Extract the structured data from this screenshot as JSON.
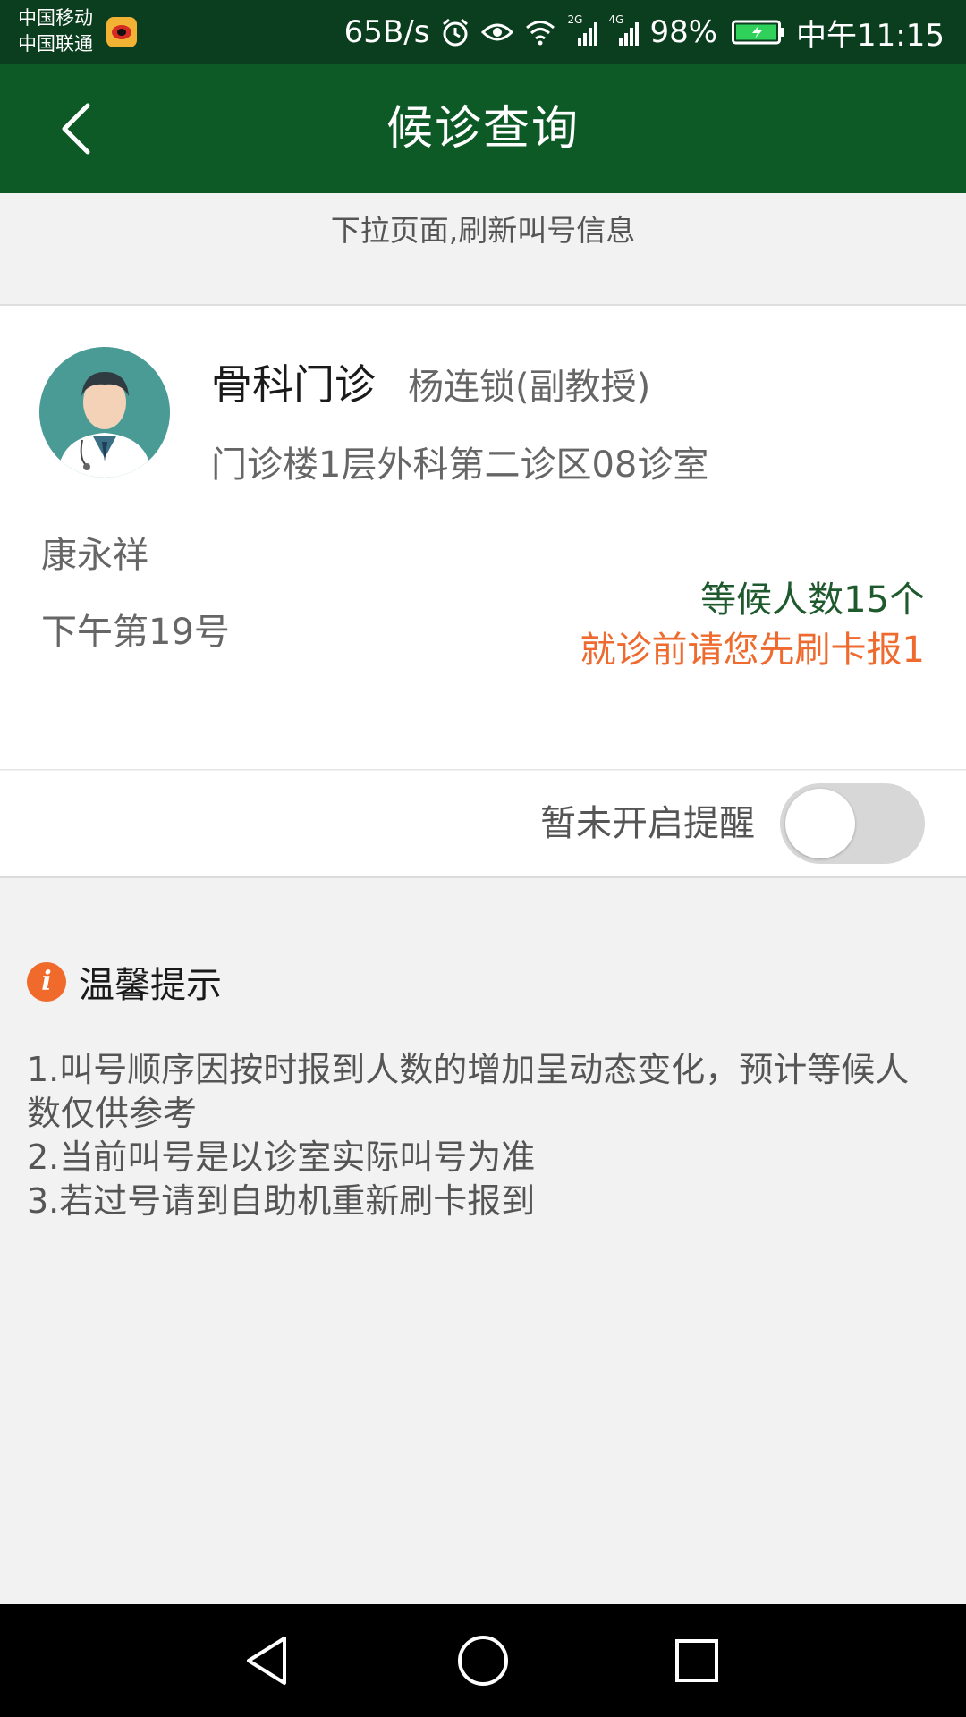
{
  "status_bar": {
    "carrier_1": "中国移动",
    "carrier_2": "中国联通",
    "net_speed": "65B/s",
    "signal_1_tag": "2G",
    "signal_2_tag": "4G",
    "battery": "98%",
    "time": "中午11:15"
  },
  "header": {
    "title": "候诊查询",
    "back_icon": "chevron-left-icon"
  },
  "refresh_hint": "下拉页面,刷新叫号信息",
  "appointment": {
    "department": "骨科门诊",
    "doctor": "杨连锁(副教授)",
    "room": "门诊楼1层外科第二诊区08诊室",
    "patient": "康永祥",
    "queue_number": "下午第19号",
    "waiting_count": "等候人数15个",
    "checkin_note": "就诊前请您先刷卡报1"
  },
  "reminder": {
    "label": "暂未开启提醒",
    "enabled": false
  },
  "tips": {
    "title": "温馨提示",
    "icon": "info-icon",
    "items": [
      "1.叫号顺序因按时报到人数的增加呈动态变化，预计等候人数仅供参考",
      "2.当前叫号是以诊室实际叫号为准",
      "3.若过号请到自助机重新刷卡报到"
    ]
  },
  "colors": {
    "status_bar": "#0b3d1f",
    "app_bar": "#0d5a27",
    "waiting_green": "#1f5a2e",
    "warning_orange": "#ee6a2e"
  }
}
